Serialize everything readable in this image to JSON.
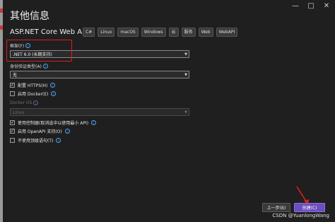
{
  "window": {
    "title": "其他信息",
    "controls": [
      "—",
      "□",
      "✕"
    ]
  },
  "template": {
    "name": "ASP.NET Core Web API",
    "tags": [
      "C#",
      "Linux",
      "macOS",
      "Windows",
      "云",
      "服务",
      "Web",
      "WebAPI"
    ]
  },
  "form": {
    "framework_label": "框架(F)",
    "framework_value": ".NET 6.0 (长期支持)",
    "auth_label": "身份验证类型(A)",
    "auth_value": "无",
    "https_label": "配置 HTTPS(H)",
    "https_checked": true,
    "docker_label": "启用 Docker(E)",
    "docker_checked": false,
    "docker_os_label": "Docker OS",
    "docker_os_value": "Linux",
    "controllers_label": "使用控制器(取消选中以使用最小 API)",
    "controllers_checked": true,
    "openapi_label": "启用 OpenAPI 支持(O)",
    "openapi_checked": true,
    "toplevel_label": "不使用顶级语句(T)",
    "toplevel_checked": false
  },
  "buttons": {
    "back": "上一步(B)",
    "create": "创建(C)"
  },
  "watermark": "CSDN @YuanlongWang",
  "colors": {
    "highlight": "#e02020",
    "primary_button": "#6b4fbf",
    "info_icon": "#4da3ff"
  }
}
